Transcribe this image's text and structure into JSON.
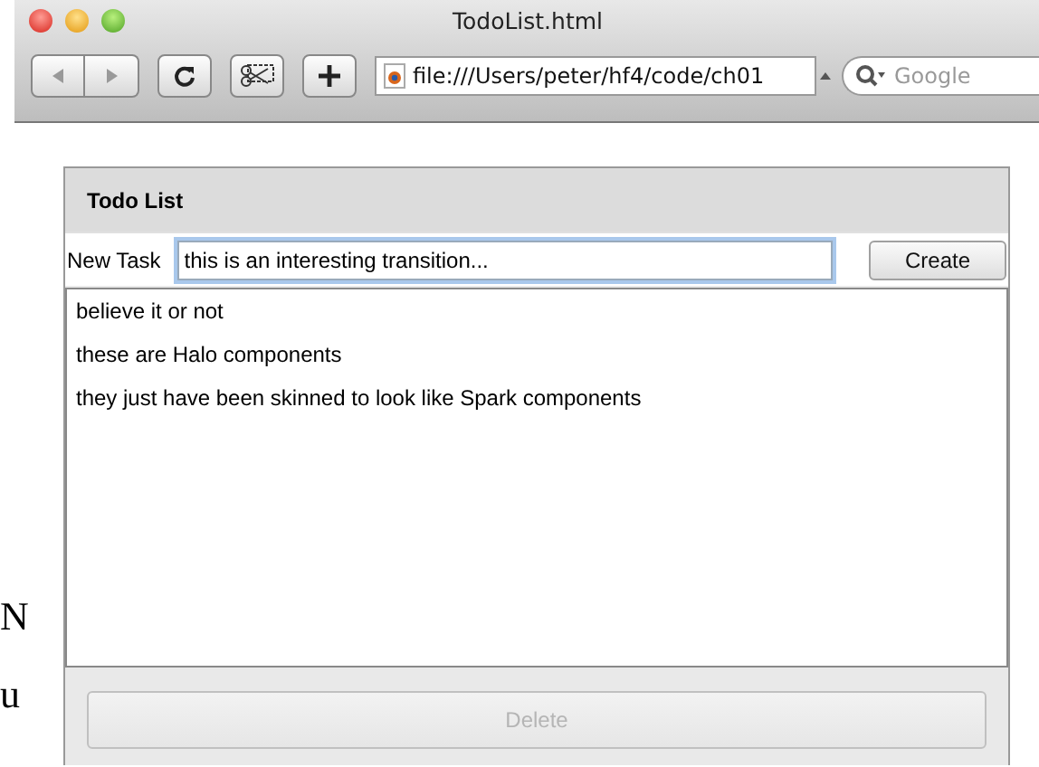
{
  "window": {
    "title": "TodoList.html"
  },
  "toolbar": {
    "address": "file:///Users/peter/hf4/code/ch01",
    "search": {
      "placeholder": "Google"
    }
  },
  "background_text": [
    "N",
    "u"
  ],
  "panel": {
    "title": "Todo List",
    "new_task": {
      "label": "New Task",
      "value": "this is an interesting transition...",
      "focused": true
    },
    "create_button": "Create",
    "items": [
      {
        "text": "believe it or not",
        "selected": false
      },
      {
        "text": "these are Halo components",
        "selected": false
      },
      {
        "text": "they just have been skinned to look like Spark components",
        "selected": false
      }
    ],
    "delete_button": {
      "label": "Delete",
      "disabled": true
    }
  }
}
